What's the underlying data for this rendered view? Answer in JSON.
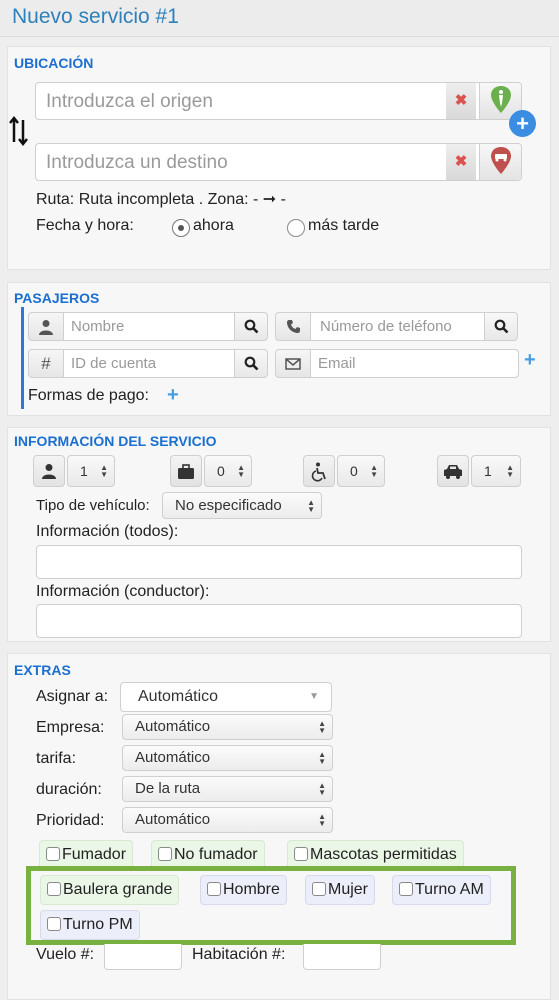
{
  "header": {
    "title": "Nuevo servicio #1"
  },
  "ubicacion": {
    "title": "UBICACIÓN",
    "origin_placeholder": "Introduzca el origen",
    "dest_placeholder": "Introduzca un destino",
    "route_line": "Ruta: Ruta incompleta . Zona: -",
    "route_dash": "-",
    "datetime_label": "Fecha y hora:",
    "opt_now": "ahora",
    "opt_later": "más tarde",
    "selected": "ahora"
  },
  "pasajeros": {
    "title": "PASAJEROS",
    "name_placeholder": "Nombre",
    "phone_placeholder": "Número de teléfono",
    "account_placeholder": "ID de cuenta",
    "email_placeholder": "Email",
    "payment_label": "Formas de pago:"
  },
  "servicio": {
    "title": "INFORMACIÓN DEL SERVICIO",
    "counts": {
      "people": "1",
      "luggage": "0",
      "wheelchair": "0",
      "vehicles": "1"
    },
    "vehicle_type_label": "Tipo de vehículo:",
    "vehicle_type_value": "No especificado",
    "info_all_label": "Información (todos):",
    "info_driver_label": "Información (conductor):"
  },
  "extras": {
    "title": "EXTRAS",
    "assign_label": "Asignar a:",
    "assign_value": "Automático",
    "company_label": "Empresa:",
    "company_value": "Automático",
    "fare_label": "tarifa:",
    "fare_value": "Automático",
    "duration_label": "duración:",
    "duration_value": "De la ruta",
    "priority_label": "Prioridad:",
    "priority_value": "Automático",
    "options": [
      {
        "label": "Fumador",
        "checked": false
      },
      {
        "label": "No fumador",
        "checked": false
      },
      {
        "label": "Mascotas permitidas",
        "checked": false
      },
      {
        "label": "Baulera grande",
        "checked": false
      },
      {
        "label": "Hombre",
        "checked": false
      },
      {
        "label": "Mujer",
        "checked": false
      },
      {
        "label": "Turno AM",
        "checked": false
      },
      {
        "label": "Turno PM",
        "checked": false
      }
    ],
    "flight_label": "Vuelo #:",
    "room_label": "Habitación #:"
  },
  "colors": {
    "accent": "#1a6fd1",
    "highlight_border": "#78b13f",
    "green_chip": "#eaf6e6",
    "blue_chip": "#eceef9"
  }
}
